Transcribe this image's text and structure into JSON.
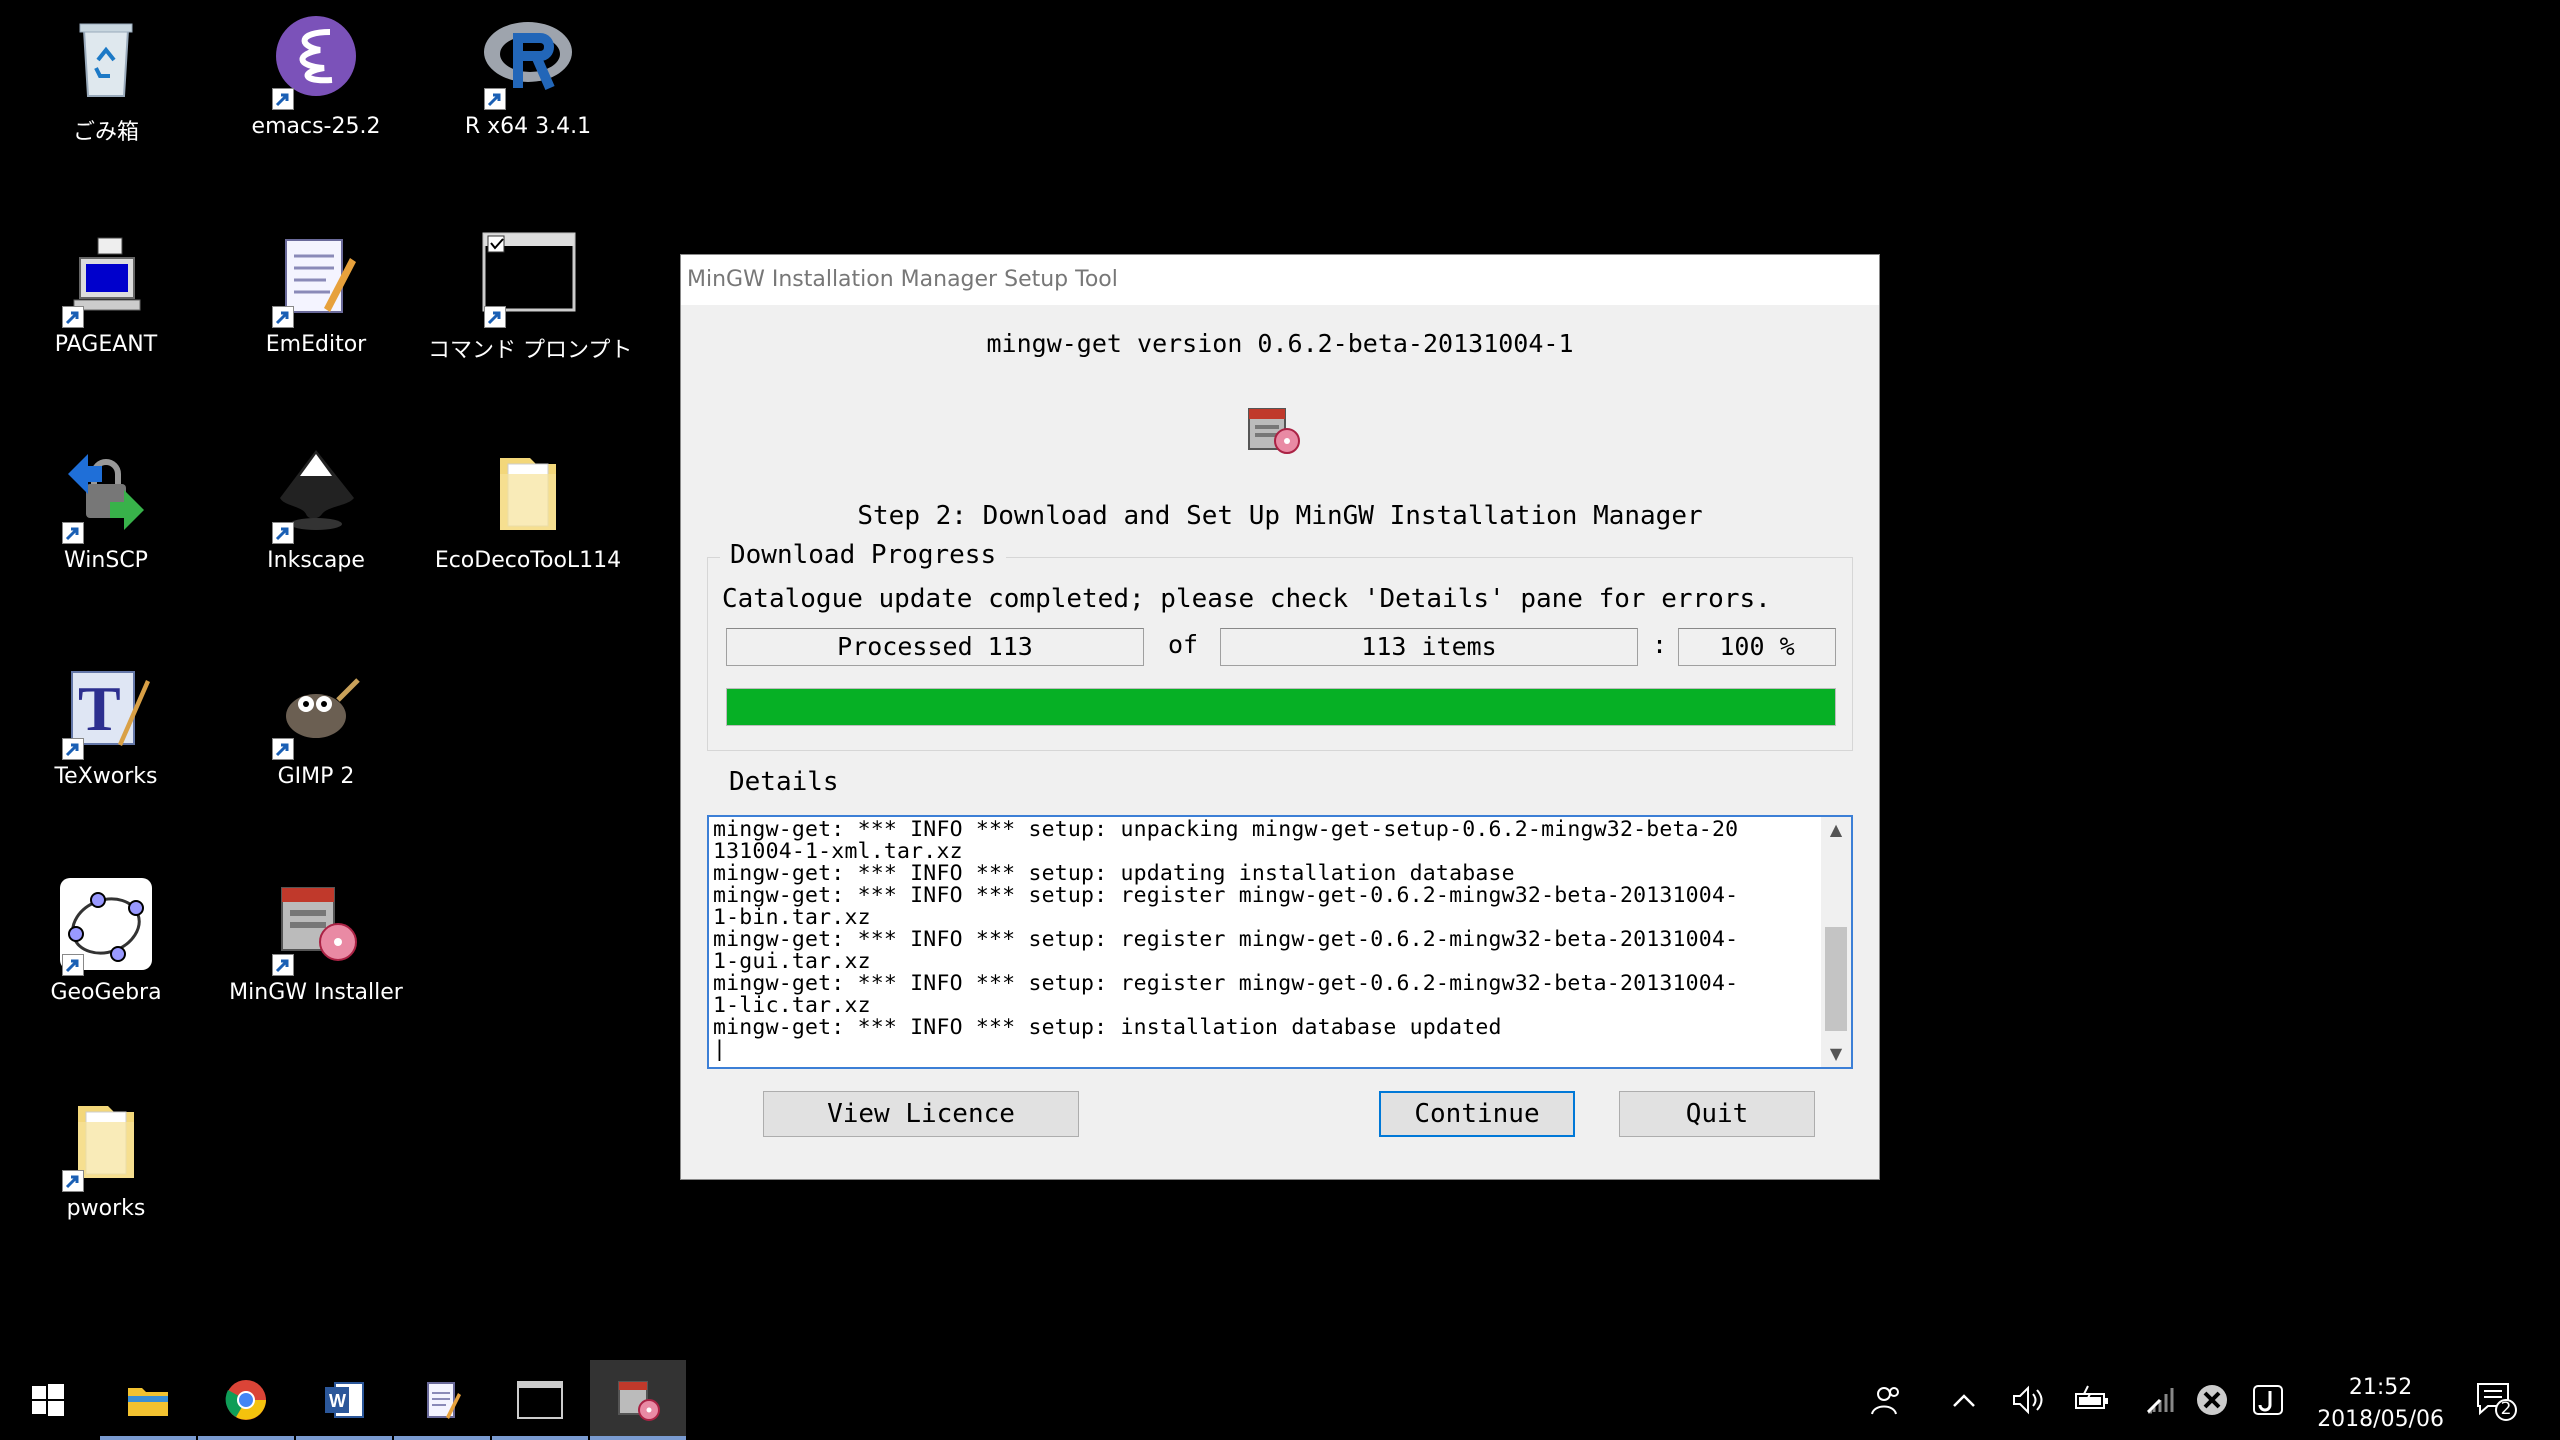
{
  "desktop": {
    "icons": [
      {
        "label": "ごみ箱"
      },
      {
        "label": "emacs-25.2"
      },
      {
        "label": "R x64 3.4.1"
      },
      {
        "label": "PAGEANT"
      },
      {
        "label": "EmEditor"
      },
      {
        "label": "コマンド プロンプト"
      },
      {
        "label": "WinSCP"
      },
      {
        "label": "Inkscape"
      },
      {
        "label": "EcoDecoTooL114"
      },
      {
        "label": "TeXworks"
      },
      {
        "label": "GIMP 2"
      },
      {
        "label": "GeoGebra"
      },
      {
        "label": "MinGW Installer"
      },
      {
        "label": "pworks"
      }
    ]
  },
  "dialog": {
    "title": "MinGW Installation Manager Setup Tool",
    "version": "mingw-get version 0.6.2-beta-20131004-1",
    "step": "Step 2: Download and Set Up MinGW Installation Manager",
    "download": {
      "group_label": "Download Progress",
      "status": "Catalogue update completed; please check 'Details' pane for errors.",
      "processed": "Processed 113",
      "of_label": "of",
      "total": "113 items",
      "colon": ":",
      "percent": "100 %",
      "progress": 1.0,
      "progress_color": "#06b025"
    },
    "details": {
      "group_label": "Details",
      "log": "mingw-get: *** INFO *** setup: unpacking mingw-get-setup-0.6.2-mingw32-beta-20\n131004-1-xml.tar.xz\nmingw-get: *** INFO *** setup: updating installation database\nmingw-get: *** INFO *** setup: register mingw-get-0.6.2-mingw32-beta-20131004-\n1-bin.tar.xz\nmingw-get: *** INFO *** setup: register mingw-get-0.6.2-mingw32-beta-20131004-\n1-gui.tar.xz\nmingw-get: *** INFO *** setup: register mingw-get-0.6.2-mingw32-beta-20131004-\n1-lic.tar.xz\nmingw-get: *** INFO *** setup: installation database updated\n|"
    },
    "buttons": {
      "view_licence": "View Licence",
      "continue": "Continue",
      "quit": "Quit"
    },
    "focus_color": "#0078d7"
  },
  "taskbar": {
    "apps": [
      "start-icon",
      "file-explorer-icon",
      "chrome-icon",
      "word-icon",
      "emeditor-icon",
      "command-prompt-icon",
      "mingw-installer-icon"
    ],
    "tray": [
      "people-icon",
      "show-hidden-icons",
      "volume-icon",
      "battery-icon",
      "wifi-icon",
      "no-network-icon",
      "app-tray-icon"
    ],
    "time": "21:52",
    "date": "2018/05/06",
    "notification_count": "2"
  }
}
